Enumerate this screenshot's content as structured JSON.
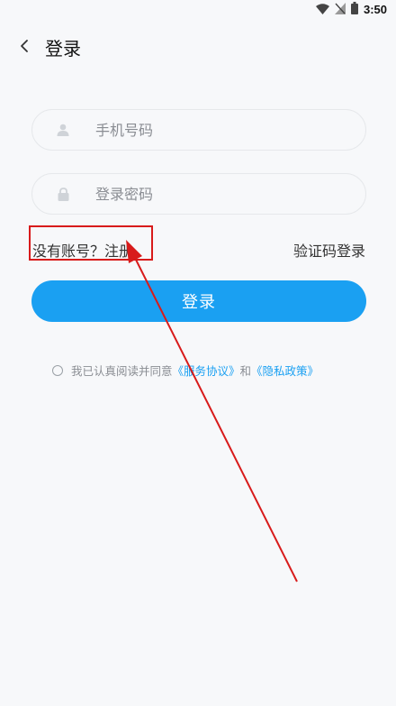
{
  "status_bar": {
    "time": "3:50"
  },
  "header": {
    "title": "登录"
  },
  "form": {
    "phone_placeholder": "手机号码",
    "password_placeholder": "登录密码",
    "register_link": "没有账号？注册",
    "sms_login_link": "验证码登录",
    "login_button": "登录"
  },
  "agreement": {
    "prefix": "我已认真阅读并同意",
    "service_link": "《服务协议》",
    "conjunction": "和",
    "privacy_link": "《隐私政策》"
  },
  "colors": {
    "accent": "#1aa0f2",
    "annotation": "#d81b1b"
  }
}
